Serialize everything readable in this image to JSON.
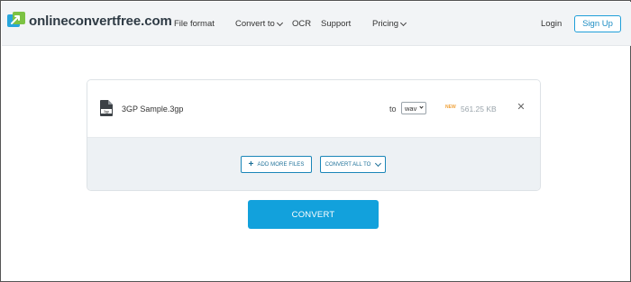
{
  "header": {
    "logo_text": "onlineconvertfree.com",
    "logo_icon": "arrow-convert-icon",
    "nav": {
      "file_format": "File format",
      "convert_to": "Convert to",
      "ocr": "OCR",
      "support": "Support",
      "pricing": "Pricing"
    },
    "login": "Login",
    "signup": "Sign Up"
  },
  "file": {
    "icon_label": "3gp",
    "name": "3GP Sample.3gp",
    "to_label": "to",
    "format": "wav",
    "new_badge": "NEW",
    "size": "561.25 KB"
  },
  "actions": {
    "add_more": "ADD MORE FILES",
    "convert_all": "CONVERT ALL TO"
  },
  "convert_label": "CONVERT",
  "colors": {
    "accent": "#12a1dc",
    "header_bg": "#f2f4f6",
    "new_badge": "#f0a13a"
  }
}
